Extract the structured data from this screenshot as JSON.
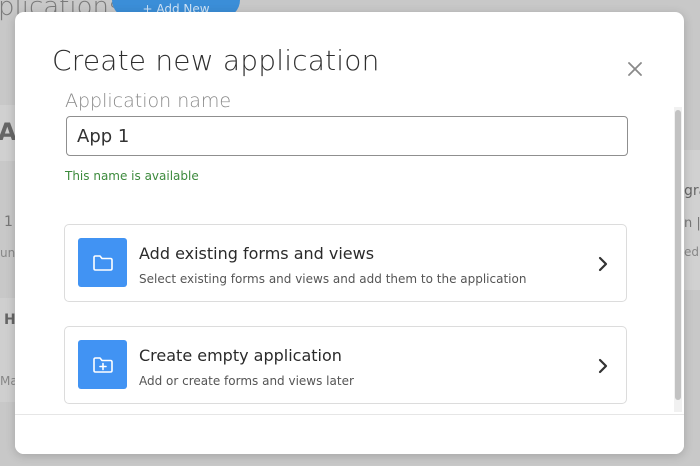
{
  "background": {
    "title_fragment": "plications",
    "button_fragment": "+ Add New",
    "left_heading_fragment": "Ap",
    "left_row1_fragment": "1",
    "left_row2_fragment": "un",
    "left_row3_fragment": "H",
    "left_row4_fragment": "Ma",
    "right_row1_fragment": "gra",
    "right_row2_fragment": "n |",
    "right_row3_fragment": "ed"
  },
  "modal": {
    "title": "Create new application",
    "close_icon": "close-icon",
    "name_field": {
      "label": "Application name",
      "value": "App 1",
      "hint": "This name is available"
    },
    "options": [
      {
        "icon": "folder-icon",
        "title": "Add existing forms and views",
        "description": "Select existing forms and views and add them to the application"
      },
      {
        "icon": "folder-plus-icon",
        "title": "Create empty application",
        "description": "Add or create forms and views later"
      }
    ]
  },
  "colors": {
    "accent": "#4193f3",
    "success": "#3c8a3c",
    "backdrop": "#c8c8c8"
  }
}
